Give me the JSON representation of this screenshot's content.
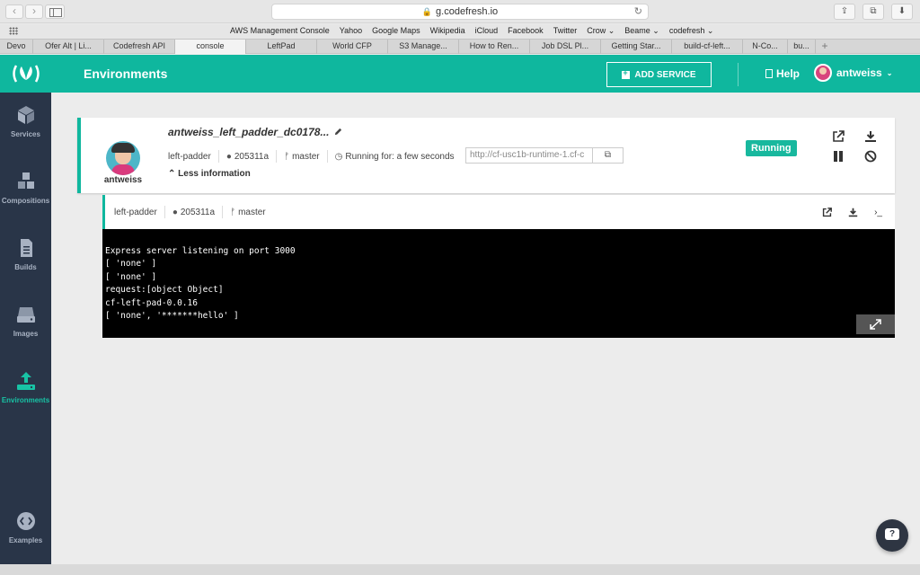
{
  "browser": {
    "url": "g.codefresh.io",
    "bookmarks": [
      "AWS Management Console",
      "Yahoo",
      "Google Maps",
      "Wikipedia",
      "iCloud",
      "Facebook",
      "Twitter",
      "Crow ⌄",
      "Beame ⌄",
      "codefresh ⌄"
    ],
    "tabs": [
      {
        "label": "Devo",
        "active": false
      },
      {
        "label": "Ofer Alt | Li...",
        "active": false
      },
      {
        "label": "Codefresh API",
        "active": false
      },
      {
        "label": "console",
        "active": true
      },
      {
        "label": "LeftPad",
        "active": false
      },
      {
        "label": "World CFP",
        "active": false
      },
      {
        "label": "S3 Manage...",
        "active": false
      },
      {
        "label": "How to Ren...",
        "active": false
      },
      {
        "label": "Job DSL Pl...",
        "active": false
      },
      {
        "label": "Getting Star...",
        "active": false
      },
      {
        "label": "build-cf-left...",
        "active": false
      },
      {
        "label": "N-Co...",
        "active": false
      },
      {
        "label": "bu...",
        "active": false
      }
    ]
  },
  "sidebar": {
    "items": [
      {
        "label": "Services",
        "icon": "cube-icon"
      },
      {
        "label": "Compositions",
        "icon": "cubes-icon"
      },
      {
        "label": "Builds",
        "icon": "document-icon"
      },
      {
        "label": "Images",
        "icon": "drive-icon"
      },
      {
        "label": "Environments",
        "icon": "upload-icon",
        "active": true
      },
      {
        "label": "Examples",
        "icon": "code-icon"
      }
    ]
  },
  "header": {
    "title": "Environments",
    "add_service": "ADD SERVICE",
    "help": "Help",
    "username": "antweiss"
  },
  "service": {
    "name": "antweiss_left_padder_dc0178...",
    "owner": "antweiss",
    "repo": "left-padder",
    "commit": "205311a",
    "branch": "master",
    "running_for": "Running for: a few seconds",
    "url": "http://cf-usc1b-runtime-1.cf-c",
    "less_info": "Less information",
    "status": "Running",
    "status_color": "#18b89e"
  },
  "container": {
    "repo": "left-padder",
    "commit": "205311a",
    "branch": "master"
  },
  "terminal": {
    "lines": [
      "Express server listening on port 3000",
      "[ 'none' ]",
      "[ 'none' ]",
      "request:[object Object]",
      "cf-left-pad-0.0.16",
      "[ 'none', '*******hello' ]"
    ]
  },
  "colors": {
    "accent": "#0fb79e",
    "sidebar_bg": "#293548"
  }
}
